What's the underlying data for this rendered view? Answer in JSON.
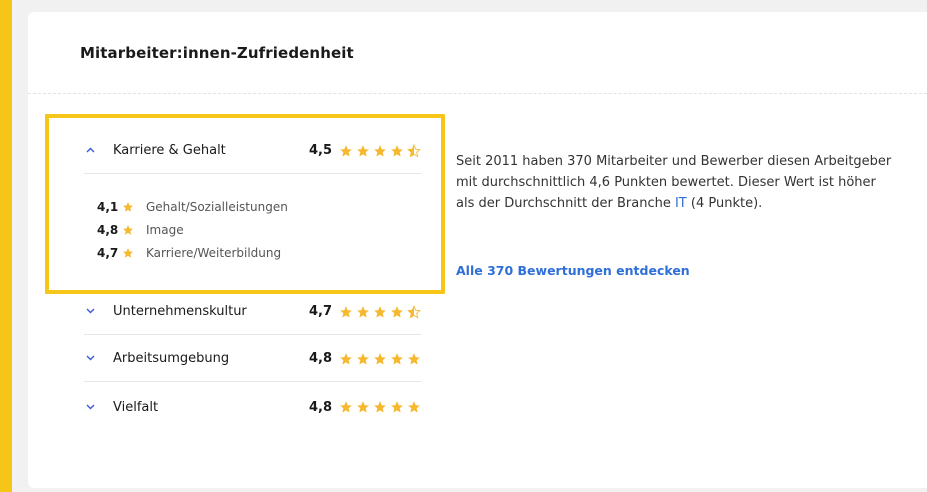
{
  "card": {
    "title": "Mitarbeiter:innen-Zufriedenheit"
  },
  "categories": [
    {
      "label": "Karriere & Gehalt",
      "score": "4,5",
      "rating": 4.5,
      "expanded": true,
      "sub": [
        {
          "score": "4,1",
          "label": "Gehalt/Sozialleistungen"
        },
        {
          "score": "4,8",
          "label": "Image"
        },
        {
          "score": "4,7",
          "label": "Karriere/Weiterbildung"
        }
      ]
    },
    {
      "label": "Unternehmenskultur",
      "score": "4,7",
      "rating": 4.5,
      "expanded": false
    },
    {
      "label": "Arbeitsumgebung",
      "score": "4,8",
      "rating": 5,
      "expanded": false
    },
    {
      "label": "Vielfalt",
      "score": "4,8",
      "rating": 5,
      "expanded": false
    }
  ],
  "description": {
    "text": "Seit 2011 haben 370 Mitarbeiter und Bewerber diesen Arbeitgeber mit durchschnittlich 4,6 Punkten bewertet. Dieser Wert ist höher als der Durchschnitt der Branche ",
    "industry_link": "IT",
    "suffix": " (4 Punkte)."
  },
  "all_reviews_link": "Alle 370 Bewertungen entdecken",
  "icons": {
    "expanded": "chevron-up-icon",
    "collapsed": "chevron-down-icon",
    "rating": "star-icon"
  },
  "colors": {
    "accent": "#f5c518",
    "star": "#f5b82e",
    "link": "#2f6fd8",
    "chevron": "#3a5bd9"
  }
}
